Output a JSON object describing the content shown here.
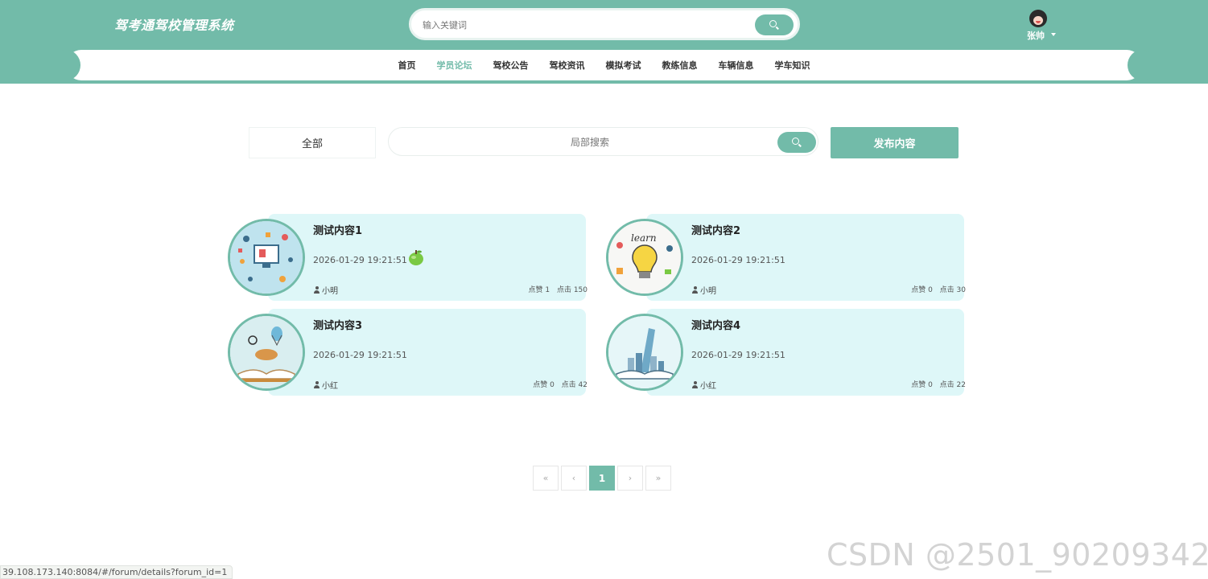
{
  "header": {
    "brand": "驾考通驾校管理系统",
    "search_placeholder": "输入关键词",
    "user_name": "张帅"
  },
  "nav": {
    "items": [
      "首页",
      "学员论坛",
      "驾校公告",
      "驾校资讯",
      "模拟考试",
      "教练信息",
      "车辆信息",
      "学车知识"
    ],
    "active": "学员论坛"
  },
  "toolbar": {
    "filter_label": "全部",
    "search_placeholder": "局部搜索",
    "publish_label": "发布内容"
  },
  "posts": [
    {
      "title": "测试内容1",
      "time": "2026-01-29 19:21:51",
      "author": "小明",
      "likes": "点赞 1",
      "clicks": "点击 150",
      "image": "icons-computer-illustration"
    },
    {
      "title": "测试内容2",
      "time": "2026-01-29 19:21:51",
      "author": "小明",
      "likes": "点赞 0",
      "clicks": "点击 30",
      "image": "learn-lightbulb-illustration"
    },
    {
      "title": "测试内容3",
      "time": "2026-01-29 19:21:51",
      "author": "小红",
      "likes": "点赞 0",
      "clicks": "点击 42",
      "image": "open-book-balloon-illustration"
    },
    {
      "title": "测试内容4",
      "time": "2026-01-29 19:21:51",
      "author": "小红",
      "likes": "点赞 0",
      "clicks": "点击 22",
      "image": "open-book-city-illustration"
    }
  ],
  "pagination": {
    "first": "«",
    "prev": "‹",
    "current": "1",
    "next": "›",
    "last": "»"
  },
  "status_url": "39.108.173.140:8084/#/forum/details?forum_id=1",
  "watermark": "CSDN @2501_90209342",
  "colors": {
    "primary": "#72bba9",
    "card_bg": "#def7f8"
  }
}
